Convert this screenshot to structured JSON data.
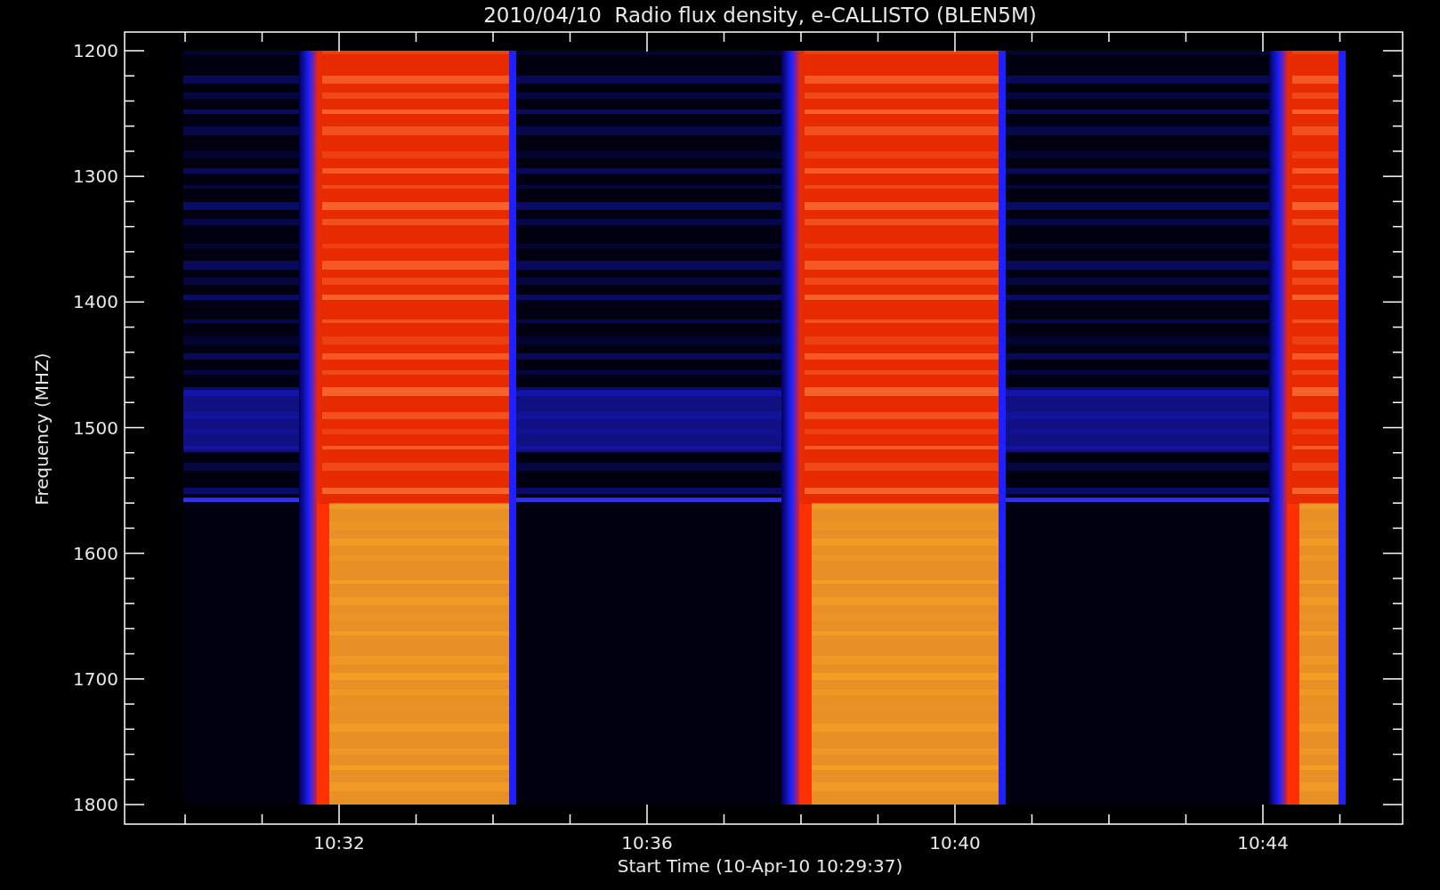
{
  "title": "2010/04/10  Radio flux density, e-CALLISTO (BLEN5M)",
  "y_axis": {
    "label": "Frequency (MHZ)",
    "ticks": [
      "1200",
      "1300",
      "1400",
      "1500",
      "1600",
      "1700",
      "1800"
    ]
  },
  "x_axis": {
    "label": "Start Time (10-Apr-10 10:29:37)",
    "ticks": [
      "10:32",
      "10:36",
      "10:40",
      "10:44"
    ]
  }
}
